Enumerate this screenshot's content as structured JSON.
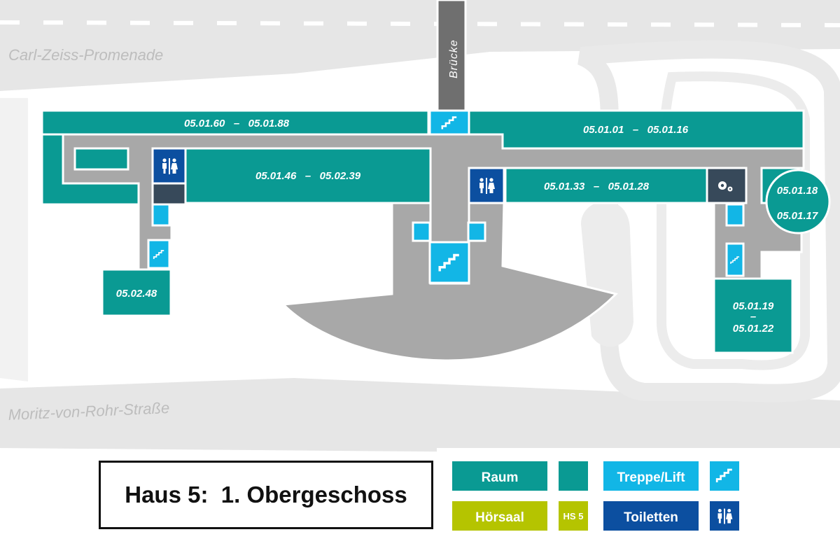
{
  "title": "Haus 5:  1. Obergeschoss",
  "streets": {
    "top": "Carl-Zeiss-Promenade",
    "bottom": "Moritz-von-Rohr-Straße",
    "bridge": "Brücke"
  },
  "rooms": {
    "r1": "05.01.60   –   05.01.88",
    "r2": "05.01.01   –   05.01.16",
    "r3": "05.01.46   –   05.02.39",
    "r4": "05.01.33   –   05.01.28",
    "r5a": "05.01.18",
    "r5b": "05.01.17",
    "r6": "05.02.48",
    "r7a": "05.01.19",
    "r7b": "–",
    "r7c": "05.01.22"
  },
  "legend": {
    "raum": "Raum",
    "hoersaal": "Hörsaal",
    "hs_sample": "HS 5",
    "treppe_lift": "Treppe/Lift",
    "toiletten": "Toiletten"
  },
  "colors": {
    "raum": "#0a9a93",
    "hoersaal": "#b5c400",
    "treppe": "#12b6e6",
    "toiletten": "#0c4fa0",
    "technik": "#37495a",
    "corridor": "#a8a8a8",
    "ground": "#e4e4e4"
  },
  "icons": [
    "stairs-icon",
    "toilet-icon",
    "gear-icon"
  ]
}
